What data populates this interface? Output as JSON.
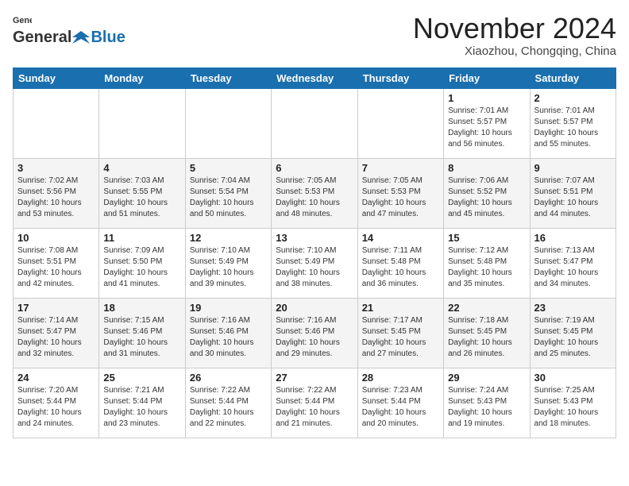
{
  "header": {
    "logo_general": "General",
    "logo_blue": "Blue",
    "month_title": "November 2024",
    "subtitle": "Xiaozhou, Chongqing, China"
  },
  "weekdays": [
    "Sunday",
    "Monday",
    "Tuesday",
    "Wednesday",
    "Thursday",
    "Friday",
    "Saturday"
  ],
  "weeks": [
    [
      {
        "day": "",
        "info": ""
      },
      {
        "day": "",
        "info": ""
      },
      {
        "day": "",
        "info": ""
      },
      {
        "day": "",
        "info": ""
      },
      {
        "day": "",
        "info": ""
      },
      {
        "day": "1",
        "info": "Sunrise: 7:01 AM\nSunset: 5:57 PM\nDaylight: 10 hours\nand 56 minutes."
      },
      {
        "day": "2",
        "info": "Sunrise: 7:01 AM\nSunset: 5:57 PM\nDaylight: 10 hours\nand 55 minutes."
      }
    ],
    [
      {
        "day": "3",
        "info": "Sunrise: 7:02 AM\nSunset: 5:56 PM\nDaylight: 10 hours\nand 53 minutes."
      },
      {
        "day": "4",
        "info": "Sunrise: 7:03 AM\nSunset: 5:55 PM\nDaylight: 10 hours\nand 51 minutes."
      },
      {
        "day": "5",
        "info": "Sunrise: 7:04 AM\nSunset: 5:54 PM\nDaylight: 10 hours\nand 50 minutes."
      },
      {
        "day": "6",
        "info": "Sunrise: 7:05 AM\nSunset: 5:53 PM\nDaylight: 10 hours\nand 48 minutes."
      },
      {
        "day": "7",
        "info": "Sunrise: 7:05 AM\nSunset: 5:53 PM\nDaylight: 10 hours\nand 47 minutes."
      },
      {
        "day": "8",
        "info": "Sunrise: 7:06 AM\nSunset: 5:52 PM\nDaylight: 10 hours\nand 45 minutes."
      },
      {
        "day": "9",
        "info": "Sunrise: 7:07 AM\nSunset: 5:51 PM\nDaylight: 10 hours\nand 44 minutes."
      }
    ],
    [
      {
        "day": "10",
        "info": "Sunrise: 7:08 AM\nSunset: 5:51 PM\nDaylight: 10 hours\nand 42 minutes."
      },
      {
        "day": "11",
        "info": "Sunrise: 7:09 AM\nSunset: 5:50 PM\nDaylight: 10 hours\nand 41 minutes."
      },
      {
        "day": "12",
        "info": "Sunrise: 7:10 AM\nSunset: 5:49 PM\nDaylight: 10 hours\nand 39 minutes."
      },
      {
        "day": "13",
        "info": "Sunrise: 7:10 AM\nSunset: 5:49 PM\nDaylight: 10 hours\nand 38 minutes."
      },
      {
        "day": "14",
        "info": "Sunrise: 7:11 AM\nSunset: 5:48 PM\nDaylight: 10 hours\nand 36 minutes."
      },
      {
        "day": "15",
        "info": "Sunrise: 7:12 AM\nSunset: 5:48 PM\nDaylight: 10 hours\nand 35 minutes."
      },
      {
        "day": "16",
        "info": "Sunrise: 7:13 AM\nSunset: 5:47 PM\nDaylight: 10 hours\nand 34 minutes."
      }
    ],
    [
      {
        "day": "17",
        "info": "Sunrise: 7:14 AM\nSunset: 5:47 PM\nDaylight: 10 hours\nand 32 minutes."
      },
      {
        "day": "18",
        "info": "Sunrise: 7:15 AM\nSunset: 5:46 PM\nDaylight: 10 hours\nand 31 minutes."
      },
      {
        "day": "19",
        "info": "Sunrise: 7:16 AM\nSunset: 5:46 PM\nDaylight: 10 hours\nand 30 minutes."
      },
      {
        "day": "20",
        "info": "Sunrise: 7:16 AM\nSunset: 5:46 PM\nDaylight: 10 hours\nand 29 minutes."
      },
      {
        "day": "21",
        "info": "Sunrise: 7:17 AM\nSunset: 5:45 PM\nDaylight: 10 hours\nand 27 minutes."
      },
      {
        "day": "22",
        "info": "Sunrise: 7:18 AM\nSunset: 5:45 PM\nDaylight: 10 hours\nand 26 minutes."
      },
      {
        "day": "23",
        "info": "Sunrise: 7:19 AM\nSunset: 5:45 PM\nDaylight: 10 hours\nand 25 minutes."
      }
    ],
    [
      {
        "day": "24",
        "info": "Sunrise: 7:20 AM\nSunset: 5:44 PM\nDaylight: 10 hours\nand 24 minutes."
      },
      {
        "day": "25",
        "info": "Sunrise: 7:21 AM\nSunset: 5:44 PM\nDaylight: 10 hours\nand 23 minutes."
      },
      {
        "day": "26",
        "info": "Sunrise: 7:22 AM\nSunset: 5:44 PM\nDaylight: 10 hours\nand 22 minutes."
      },
      {
        "day": "27",
        "info": "Sunrise: 7:22 AM\nSunset: 5:44 PM\nDaylight: 10 hours\nand 21 minutes."
      },
      {
        "day": "28",
        "info": "Sunrise: 7:23 AM\nSunset: 5:44 PM\nDaylight: 10 hours\nand 20 minutes."
      },
      {
        "day": "29",
        "info": "Sunrise: 7:24 AM\nSunset: 5:43 PM\nDaylight: 10 hours\nand 19 minutes."
      },
      {
        "day": "30",
        "info": "Sunrise: 7:25 AM\nSunset: 5:43 PM\nDaylight: 10 hours\nand 18 minutes."
      }
    ]
  ]
}
